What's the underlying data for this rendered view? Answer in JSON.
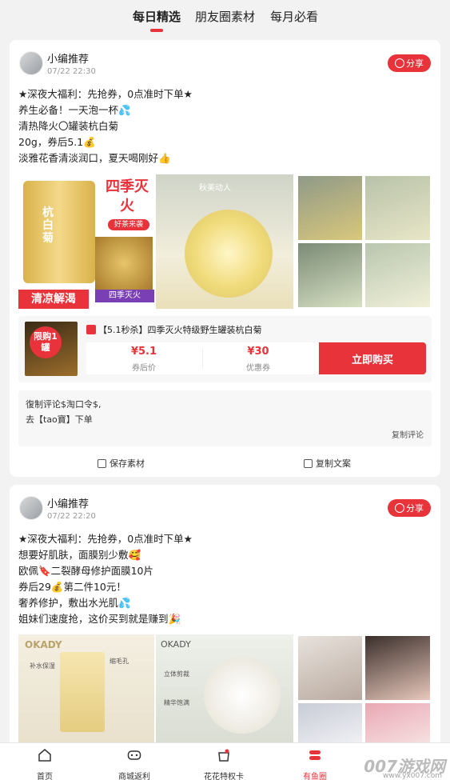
{
  "tabs": [
    {
      "label": "每日精选",
      "active": true
    },
    {
      "label": "朋友圈素材",
      "active": false
    },
    {
      "label": "每月必看",
      "active": false
    }
  ],
  "posts": [
    {
      "author": "小编推荐",
      "time": "07/22 22:30",
      "share_label": "分享",
      "lines": [
        "★深夜大福利：先抢券，0点准时下单★",
        "养生必备！一天泡一杯💦",
        "清热降火〇罐装杭白菊",
        "20g，券后5.1💰",
        "淡雅花香清淡润口，夏天喝刚好👍"
      ],
      "image_texts": {
        "big_label": "四季灭火",
        "sub_label": "好茶来袭",
        "jar_text": "杭白菊",
        "banner": "清凉解渴",
        "banner2": "四季灭火",
        "photo_tag": "秋美动人"
      },
      "product": {
        "thumb_badge": "限购1罐",
        "title": "【5.1秒杀】四季灭火特级野生罐装杭白菊",
        "price_after": "¥5.1",
        "price_after_label": "券后价",
        "coupon": "¥30",
        "coupon_label": "优惠券",
        "buy_label": "立即购买"
      },
      "comment": {
        "line1": "復制评论$淘口令$,",
        "line2": "去【tao寶】下单",
        "copy_label": "复制评论"
      },
      "actions": {
        "save": "保存素材",
        "copy": "复制文案"
      }
    },
    {
      "author": "小编推荐",
      "time": "07/22 22:20",
      "share_label": "分享",
      "lines": [
        "★深夜大福利：先抢券，0点准时下单★",
        "想要好肌肤，面膜别少敷🥰",
        "欧佩🔖二裂酵母修护面膜10片",
        "券后29💰第二件10元！",
        "奢养修护，敷出水光肌💦",
        "姐妹们速度抢，这价买到就是赚到🎉"
      ],
      "image_texts": {
        "brand1": "OKADY",
        "brand2": "OKADY",
        "tag1": "补水保湿",
        "tag2": "缩毛孔",
        "tag3": "立体剪裁",
        "tag4": "精华饱满"
      }
    }
  ],
  "bottom_nav": [
    {
      "label": "首页",
      "icon": "home-icon",
      "active": false
    },
    {
      "label": "商城返利",
      "icon": "gamepad-icon",
      "active": false
    },
    {
      "label": "花花特权卡",
      "icon": "gift-icon",
      "active": false
    },
    {
      "label": "有鱼圈",
      "icon": "circle-icon",
      "active": true
    }
  ],
  "watermark": {
    "brand": "007游戏网",
    "url": "www.yx007.com"
  },
  "colors": {
    "accent": "#e8333a",
    "bg": "#f2f2f2"
  }
}
